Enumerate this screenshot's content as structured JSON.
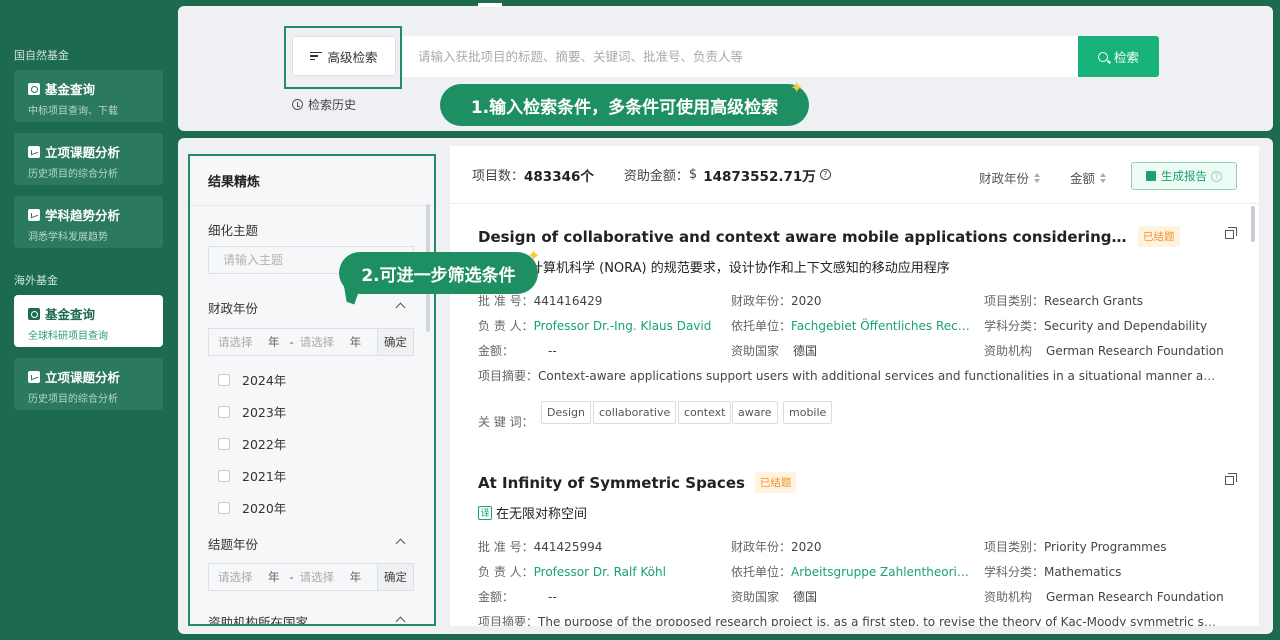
{
  "sidebar": {
    "section_domestic": "国自然基金",
    "section_overseas": "海外基金",
    "domestic_items": [
      {
        "title": "基金查询",
        "sub": "中标项目查询、下载"
      },
      {
        "title": "立项课题分析",
        "sub": "历史项目的综合分析"
      },
      {
        "title": "学科趋势分析",
        "sub": "洞悉学科发展趋势"
      }
    ],
    "overseas_items": [
      {
        "title": "基金查询",
        "sub": "全球科研项目查询"
      },
      {
        "title": "立项课题分析",
        "sub": "历史项目的综合分析"
      }
    ]
  },
  "search": {
    "advanced_label": "高级检索",
    "placeholder": "请输入获批项目的标题、摘要、关键词、批准号、负责人等",
    "button_label": "检索",
    "history_label": "检索历史"
  },
  "tips": {
    "tip1": "1.输入检索条件，多条件可使用高级检索",
    "tip2": "2.可进一步筛选条件"
  },
  "filter": {
    "title": "结果精炼",
    "topic_label": "细化主题",
    "topic_placeholder": "请输入主题",
    "fiscal_year_label": "财政年份",
    "range_placeholder": "请选择",
    "year_unit": "年",
    "dash": "-",
    "confirm": "确定",
    "years": [
      "2024年",
      "2023年",
      "2022年",
      "2021年",
      "2020年"
    ],
    "end_year_label": "结题年份",
    "country_label": "资助机构所在国家"
  },
  "results": {
    "count_label": "项目数：",
    "count_value": "483346个",
    "amount_label": "资助金额：",
    "amount_currency": "$",
    "amount_value": "14873552.71万",
    "help": "?",
    "sort_year": "财政年份",
    "sort_amount": "金额",
    "report_label": "生成报告",
    "items": [
      {
        "title": "Design of collaborative and context aware mobile applications considering norm…",
        "badge": "已结题",
        "subtitle": "律科学和计算机科学 (NORA) 的规范要求，设计协作和上下文感知的移动应用程序",
        "approval_label": "批 准 号：",
        "approval": "441416429",
        "fy_label": "财政年份：",
        "fy": "2020",
        "type_label": "项目类别：",
        "type": "Research Grants",
        "pi_label": "负 责 人：",
        "pi": "Professor Dr.-Ing. Klaus David",
        "org_label": "依托单位：",
        "org": "Fachgebiet Öffentliches Rec…",
        "field_label": "学科分类：",
        "field": "Security and Dependability",
        "amount_label": "金额：",
        "amount": "--",
        "country_label": "资助国家",
        "country": "德国",
        "funder_label": "资助机构",
        "funder": "German Research Foundation",
        "abstract_label": "项目摘要：",
        "abstract": "Context-aware applications support users with additional services and functionalities in a situational manner an…",
        "kw_label": "关 键 词：",
        "keywords": [
          "Design",
          "collaborative",
          "context",
          "aware",
          "mobile"
        ]
      },
      {
        "title": "At Infinity of Symmetric Spaces",
        "badge": "已结题",
        "trans": "译",
        "subtitle": "在无限对称空间",
        "approval_label": "批 准 号：",
        "approval": "441425994",
        "fy_label": "财政年份：",
        "fy": "2020",
        "type_label": "项目类别：",
        "type": "Priority Programmes",
        "pi_label": "负 责 人：",
        "pi": "Professor Dr. Ralf Köhl",
        "org_label": "依托单位：",
        "org": "Arbeitsgruppe Zahlentheori…",
        "field_label": "学科分类：",
        "field": "Mathematics",
        "amount_label": "金额：",
        "amount": "--",
        "country_label": "资助国家",
        "country": "德国",
        "funder_label": "资助机构",
        "funder": "German Research Foundation",
        "abstract_label": "项目摘要：",
        "abstract": "The purpose of the proposed research project is, as a first step, to revise the theory of Kac-Moody symmetric spac…"
      }
    ]
  },
  "colors": {
    "brand": "#1d6b4f",
    "accent": "#18b37b",
    "link": "#18a26f",
    "badge": "#f0932b"
  }
}
